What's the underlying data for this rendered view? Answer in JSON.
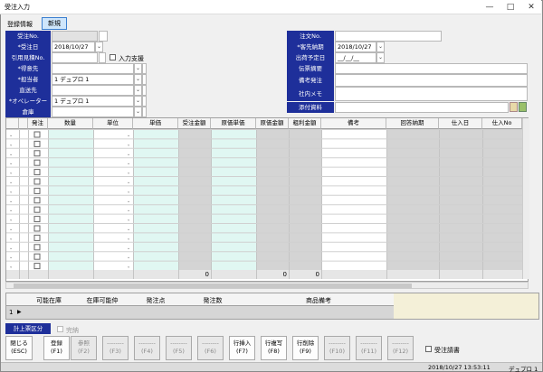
{
  "window": {
    "title": "受注入力",
    "min": "—",
    "max": "□",
    "close": "✕"
  },
  "tabs": {
    "info": "登録情報",
    "mode": "新規"
  },
  "left": {
    "order_no_label": "受注No.",
    "order_no": "",
    "order_date_label": "*受注日",
    "order_date": "2018/10/27",
    "quote_label": "引用見積No.",
    "quote": "",
    "input_support": "入力支援",
    "customer_label": "*得意先",
    "customer": "",
    "staff_label": "*担当者",
    "staff": "1 デュプロ 1",
    "ship_label": "直送先",
    "ship": "",
    "operator_label": "*オペレーター",
    "operator": "1 デュプロ 1",
    "warehouse_label": "倉庫",
    "warehouse": ""
  },
  "right": {
    "po_label": "注文No.",
    "po": "",
    "due_label": "*客先納期",
    "due": "2018/10/27",
    "shipdate_label": "出荷予定日",
    "shipdate": "__/__/__",
    "slip_label": "伝票摘要",
    "slip": "",
    "note_label": "備考発注",
    "note": "",
    "memo_label": "社内メモ",
    "memo": "",
    "attach_label": "添付資料",
    "attach": ""
  },
  "grid": {
    "headers": [
      "発注",
      "数量",
      "単位",
      "単価",
      "受注金額",
      "原価単価",
      "原価金額",
      "粗利金額",
      "備考",
      "回答納期",
      "仕入日",
      "仕入No"
    ],
    "totals": [
      "0",
      "0",
      "0"
    ]
  },
  "bottom": {
    "headers": [
      "可能在庫",
      "在庫可能仲",
      "発注点",
      "発注数",
      "商品備考"
    ],
    "row": "1"
  },
  "calc": {
    "label": "計上票区分",
    "complete": "完納"
  },
  "fkeys": [
    {
      "l1": "閉じる",
      "l2": "(ESC)"
    },
    {
      "l1": "登録",
      "l2": "(F1)"
    },
    {
      "l1": "参照",
      "l2": "(F2)"
    },
    {
      "l1": "--------",
      "l2": "(F3)"
    },
    {
      "l1": "--------",
      "l2": "(F4)"
    },
    {
      "l1": "--------",
      "l2": "(F5)"
    },
    {
      "l1": "--------",
      "l2": "(F6)"
    },
    {
      "l1": "行挿入",
      "l2": "(F7)"
    },
    {
      "l1": "行複写",
      "l2": "(F8)"
    },
    {
      "l1": "行削除",
      "l2": "(F9)"
    },
    {
      "l1": "--------",
      "l2": "(F10)"
    },
    {
      "l1": "--------",
      "l2": "(F11)"
    },
    {
      "l1": "--------",
      "l2": "(F12)"
    }
  ],
  "order_form": "受注請書",
  "status": {
    "datetime": "2018/10/27 13:53:11",
    "user": "デュプロ 1"
  }
}
